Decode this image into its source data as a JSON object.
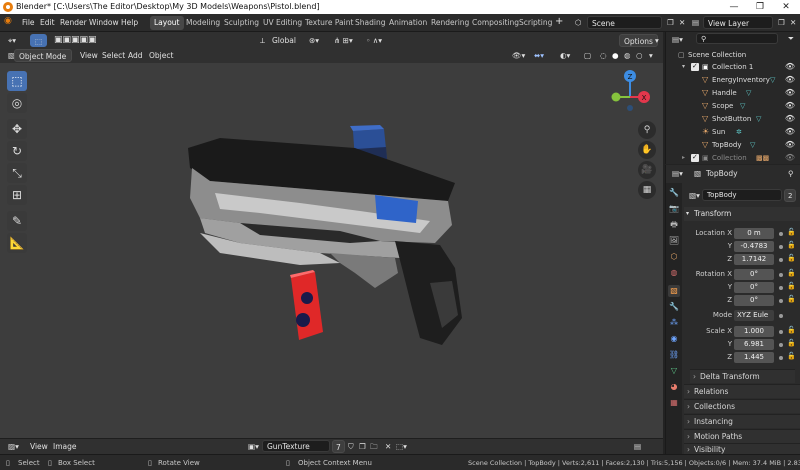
{
  "window": {
    "title": "Blender* [C:\\Users\\The Editor\\Desktop\\My 3D Models\\Weapons\\Pistol.blend]",
    "minimize": "—",
    "maximize": "❐",
    "close": "✕"
  },
  "menu": [
    "File",
    "Edit",
    "Render",
    "Window",
    "Help"
  ],
  "workspaces": [
    "Layout",
    "Modeling",
    "Sculpting",
    "UV Editing",
    "Texture Paint",
    "Shading",
    "Animation",
    "Rendering",
    "Compositing",
    "Scripting"
  ],
  "scene": {
    "label": "Scene"
  },
  "view_layer": {
    "label": "View Layer"
  },
  "viewport": {
    "mode": "Object Mode",
    "menus": [
      "View",
      "Select",
      "Add",
      "Object"
    ],
    "orientation": "Global",
    "options": "Options",
    "gizmo": {
      "z": "Z",
      "x": "X",
      "y": "Y"
    }
  },
  "image_editor": {
    "menus": [
      "View",
      "Image"
    ],
    "image_name": "GunTexture",
    "users": "7"
  },
  "status": {
    "select": "Select",
    "box_select": "Box Select",
    "rotate": "Rotate View",
    "context_menu": "Object Context Menu",
    "stats": "Scene Collection | TopBody | Verts:2,611 | Faces:2,130 | Tris:5,156 | Objects:0/6 | Mem: 37.4 MiB | 2.83.1"
  },
  "outliner": {
    "root": "Scene Collection",
    "collection": "Collection 1",
    "items": [
      "EnergyInventory",
      "Handle",
      "Scope",
      "ShotButton",
      "Sun",
      "TopBody"
    ],
    "collection2": "Collection"
  },
  "properties": {
    "header_object": "TopBody",
    "object_name": "TopBody",
    "users": "2",
    "transform_label": "Transform",
    "location_label": "Location X",
    "location": [
      "0 m",
      "-0.4783",
      "1.7142"
    ],
    "rotation_label": "Rotation X",
    "rotation": [
      "0°",
      "0°",
      "0°"
    ],
    "axis_y": "Y",
    "axis_z": "Z",
    "mode_label": "Mode",
    "mode_value": "XYZ Eule",
    "scale_label": "Scale X",
    "scale": [
      "1.000",
      "6.981",
      "1.445"
    ],
    "sections": [
      "Delta Transform",
      "Relations",
      "Collections",
      "Instancing",
      "Motion Paths",
      "Visibility"
    ]
  },
  "colors": {
    "accent": "#4772b3",
    "blender_orange": "#e87d0d",
    "gizmo_x": "#e3374c",
    "gizmo_y": "#86c33d",
    "gizmo_z": "#3d8de3"
  }
}
